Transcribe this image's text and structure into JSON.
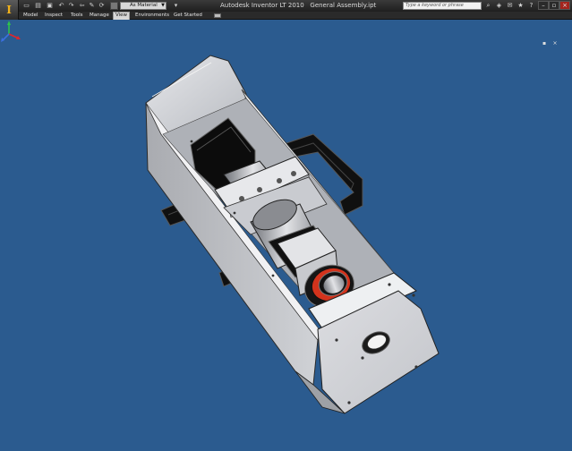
{
  "titlebar": {
    "app_title": "Autodesk Inventor LT 2010",
    "document_title": "General Assembly.ipt",
    "material_value": "As Material",
    "search_placeholder": "Type a keyword or phrase",
    "app_logo": "I"
  },
  "ribbon": {
    "tabs": [
      {
        "label": "Model"
      },
      {
        "label": "Inspect"
      },
      {
        "label": "Tools"
      },
      {
        "label": "Manage"
      },
      {
        "label": "View"
      },
      {
        "label": "Environments"
      },
      {
        "label": "Get Started"
      }
    ],
    "active_tab": "View"
  },
  "viewport": {
    "background_color": "#2b5b8f",
    "close_glyph": "×"
  },
  "icons": {
    "quick_access": [
      "new-icon",
      "open-icon",
      "save-icon",
      "undo-icon",
      "redo-icon",
      "return-icon",
      "sketch-icon",
      "update-icon",
      "select-icon"
    ],
    "right": [
      "search-go-icon",
      "infocenter-icon",
      "communication-icon",
      "favorites-icon",
      "help-icon"
    ],
    "window": [
      "minimize-icon",
      "restore-icon",
      "close-icon"
    ]
  }
}
